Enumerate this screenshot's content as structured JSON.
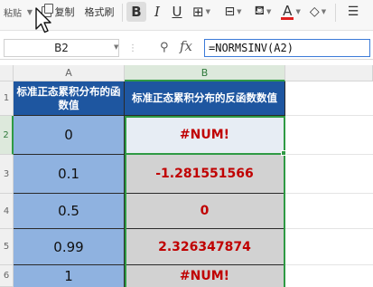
{
  "toolbar": {
    "paste_label": "粘贴",
    "copy_label": "复制",
    "format_painter_label": "格式刷",
    "bold_label": "B",
    "italic_label": "I",
    "underline_label": "U",
    "font_color_label": "A",
    "font_color": "#e02020"
  },
  "formula_bar": {
    "cell_ref": "B2",
    "fx_label": "fx",
    "formula": "=NORMSINV(A2)"
  },
  "columns": [
    "A",
    "B"
  ],
  "rows": [
    "1",
    "2",
    "3",
    "4",
    "5",
    "6"
  ],
  "table": {
    "header_a": "标准正态累积分布的函数值",
    "header_b": "标准正态累积分布的反函数数值",
    "inputs": [
      "0",
      "0.1",
      "0.5",
      "0.99",
      "1"
    ],
    "results": [
      "#NUM!",
      "-1.281551566",
      "0",
      "2.326347874",
      "#NUM!"
    ]
  },
  "colors": {
    "header_bg": "#1e56a0",
    "input_bg": "#8fb2e0",
    "result_bg": "#d2d2d2",
    "result_text": "#c00000",
    "selection": "#2f9a44"
  }
}
